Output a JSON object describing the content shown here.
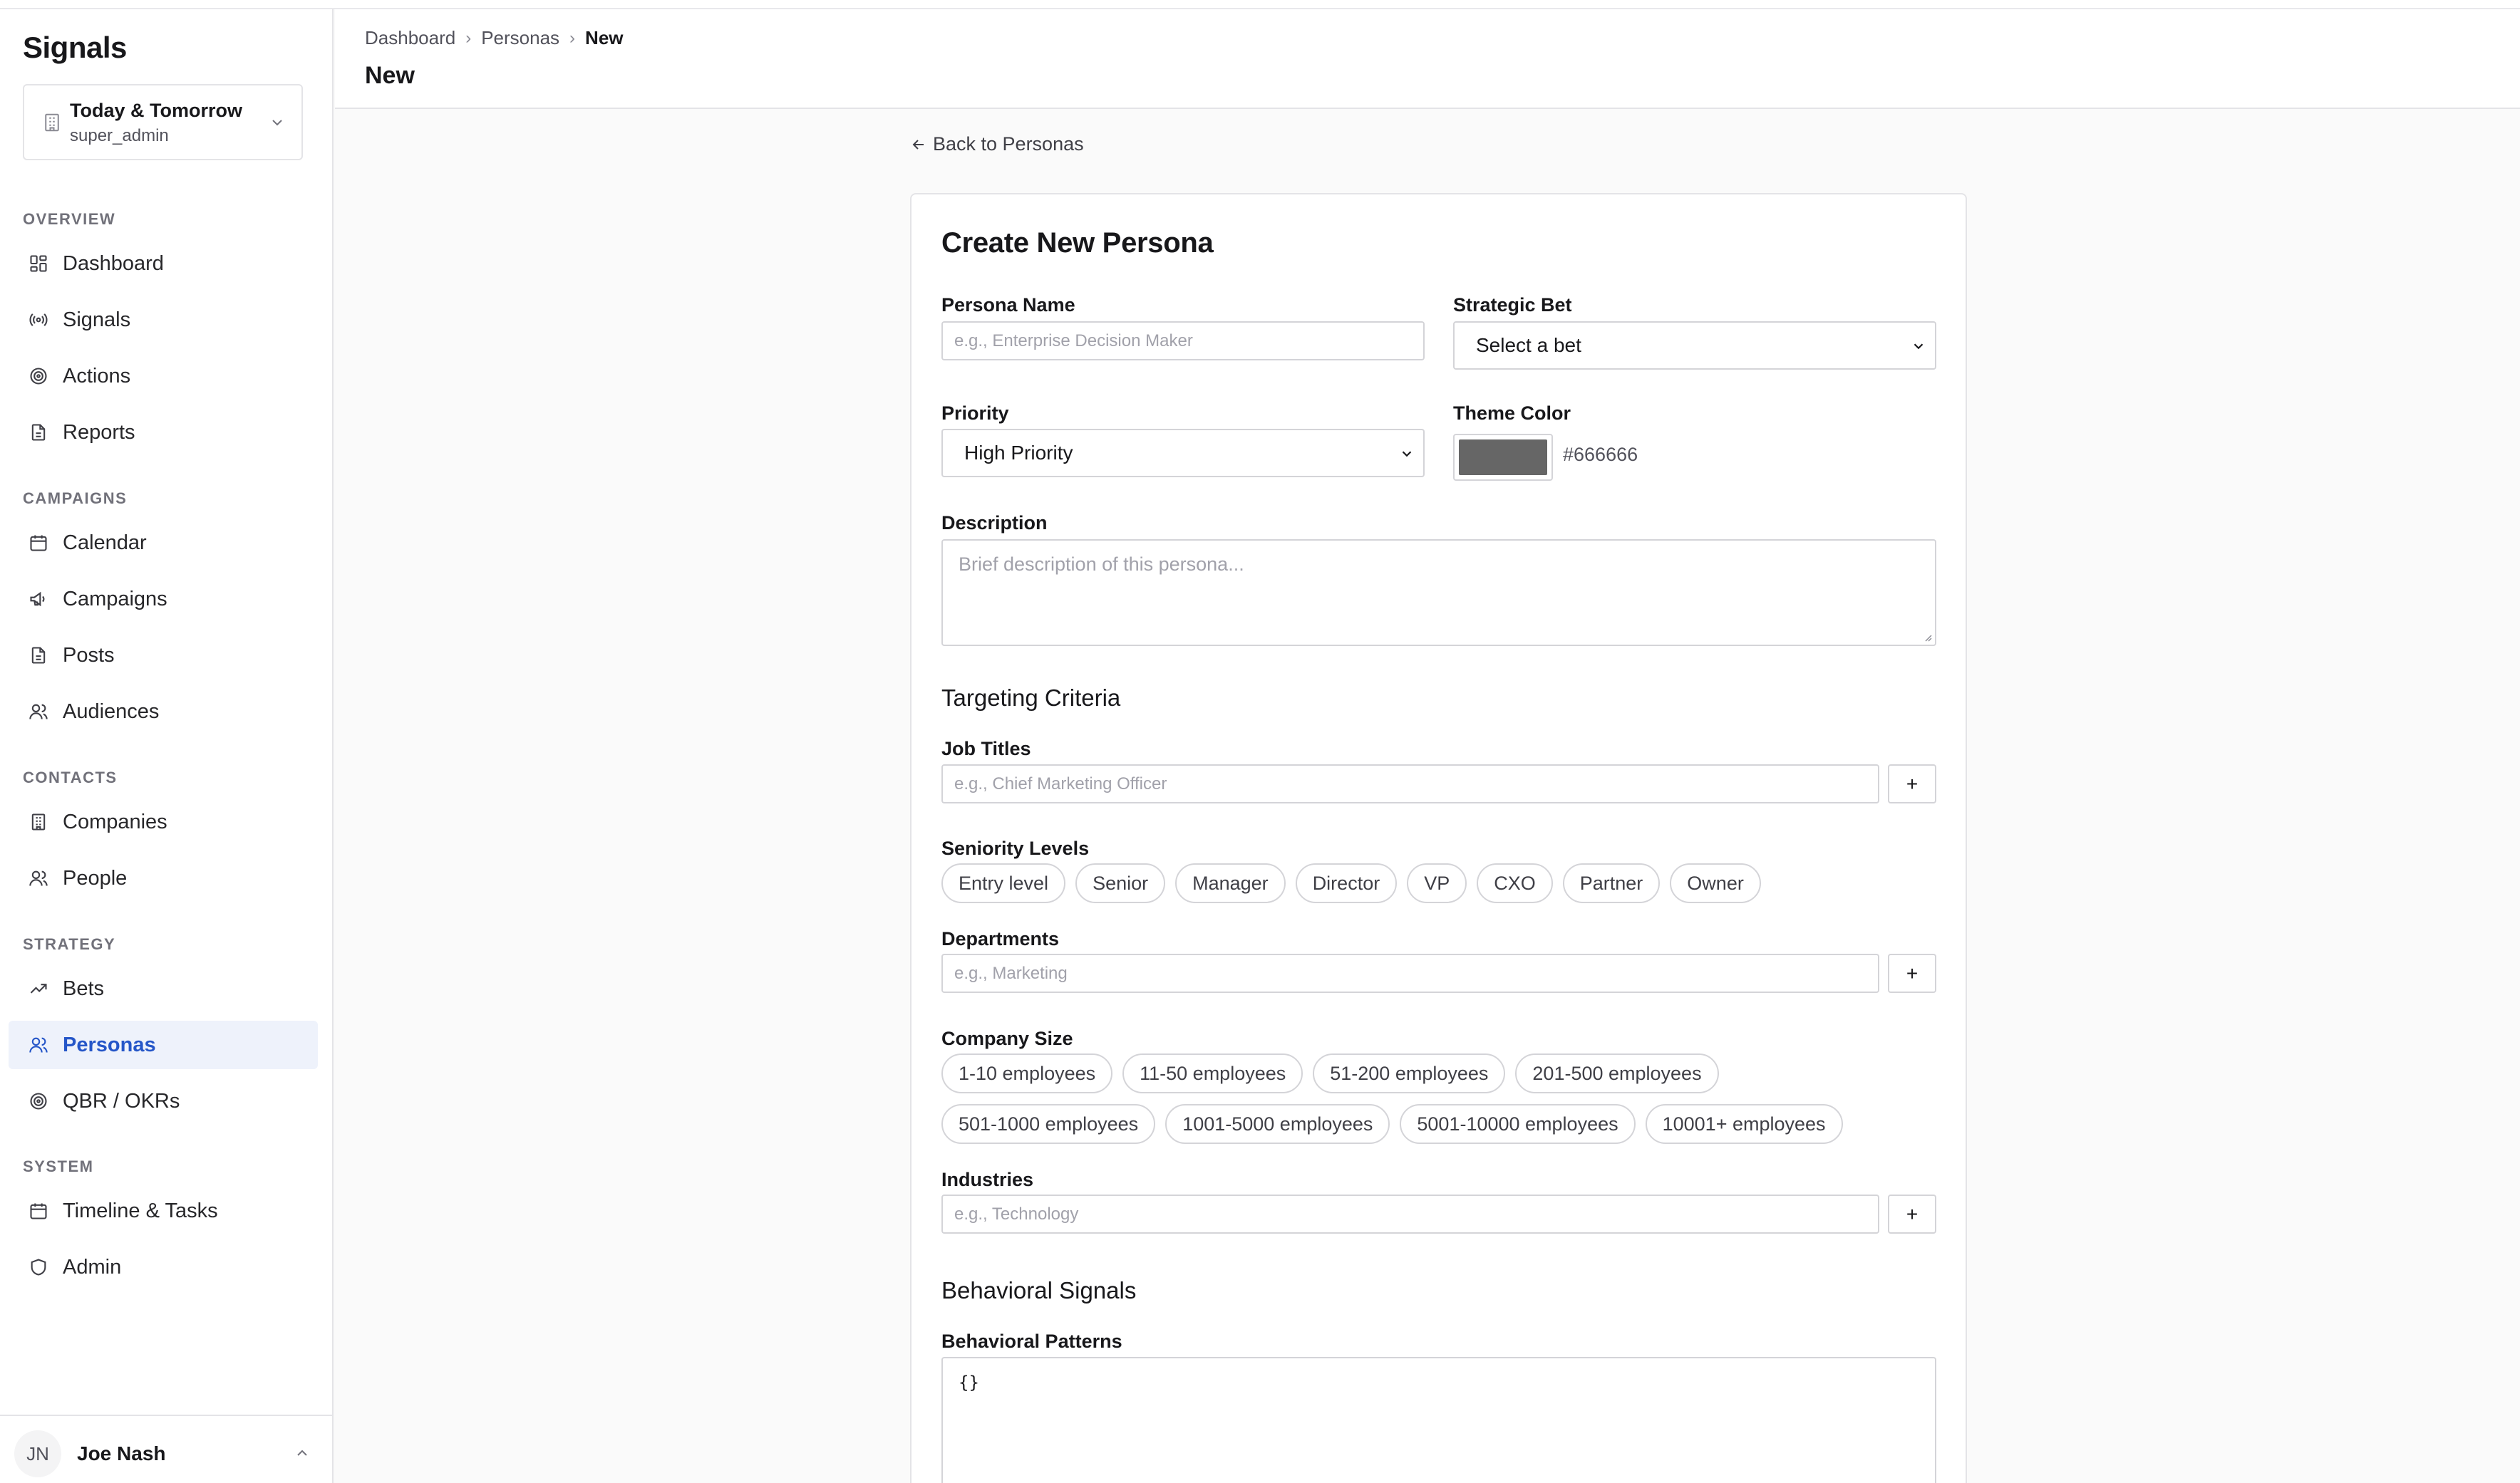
{
  "app": {
    "brand": "Signals",
    "workspace": {
      "name": "Today & Tomorrow",
      "role": "super_admin"
    }
  },
  "sidebar": {
    "sections": [
      {
        "title": "OVERVIEW",
        "items": [
          {
            "label": "Dashboard",
            "icon": "dashboard-icon"
          },
          {
            "label": "Signals",
            "icon": "radio-icon"
          },
          {
            "label": "Actions",
            "icon": "target-icon"
          },
          {
            "label": "Reports",
            "icon": "document-icon"
          }
        ]
      },
      {
        "title": "CAMPAIGNS",
        "items": [
          {
            "label": "Calendar",
            "icon": "calendar-icon"
          },
          {
            "label": "Campaigns",
            "icon": "megaphone-icon"
          },
          {
            "label": "Posts",
            "icon": "document-icon"
          },
          {
            "label": "Audiences",
            "icon": "users-icon"
          }
        ]
      },
      {
        "title": "CONTACTS",
        "items": [
          {
            "label": "Companies",
            "icon": "building-icon"
          },
          {
            "label": "People",
            "icon": "users-icon"
          }
        ]
      },
      {
        "title": "STRATEGY",
        "items": [
          {
            "label": "Bets",
            "icon": "trending-up-icon"
          },
          {
            "label": "Personas",
            "icon": "users-icon",
            "active": true
          },
          {
            "label": "QBR / OKRs",
            "icon": "target-icon"
          }
        ]
      },
      {
        "title": "SYSTEM",
        "items": [
          {
            "label": "Timeline & Tasks",
            "icon": "calendar-icon"
          },
          {
            "label": "Admin",
            "icon": "shield-icon"
          }
        ]
      }
    ],
    "user": {
      "initials": "JN",
      "name": "Joe Nash"
    }
  },
  "header": {
    "breadcrumbs": [
      "Dashboard",
      "Personas",
      "New"
    ],
    "title": "New"
  },
  "main": {
    "back_link": "Back to Personas",
    "form": {
      "title": "Create New Persona",
      "persona_name": {
        "label": "Persona Name",
        "placeholder": "e.g., Enterprise Decision Maker"
      },
      "strategic_bet": {
        "label": "Strategic Bet",
        "value": "Select a bet"
      },
      "priority": {
        "label": "Priority",
        "value": "High Priority"
      },
      "theme_color": {
        "label": "Theme Color",
        "value": "#666666"
      },
      "description": {
        "label": "Description",
        "placeholder": "Brief description of this persona..."
      },
      "targeting_heading": "Targeting Criteria",
      "job_titles": {
        "label": "Job Titles",
        "placeholder": "e.g., Chief Marketing Officer",
        "add": "+"
      },
      "seniority": {
        "label": "Seniority Levels",
        "options": [
          "Entry level",
          "Senior",
          "Manager",
          "Director",
          "VP",
          "CXO",
          "Partner",
          "Owner"
        ]
      },
      "departments": {
        "label": "Departments",
        "placeholder": "e.g., Marketing",
        "add": "+"
      },
      "company_size": {
        "label": "Company Size",
        "row1": [
          "1-10 employees",
          "11-50 employees",
          "51-200 employees",
          "201-500 employees"
        ],
        "row2": [
          "501-1000 employees",
          "1001-5000 employees",
          "5001-10000 employees",
          "10001+ employees"
        ]
      },
      "industries": {
        "label": "Industries",
        "placeholder": "e.g., Technology",
        "add": "+"
      },
      "behavioral_heading": "Behavioral Signals",
      "behavioral_patterns": {
        "label": "Behavioral Patterns",
        "value": "{}"
      }
    }
  }
}
